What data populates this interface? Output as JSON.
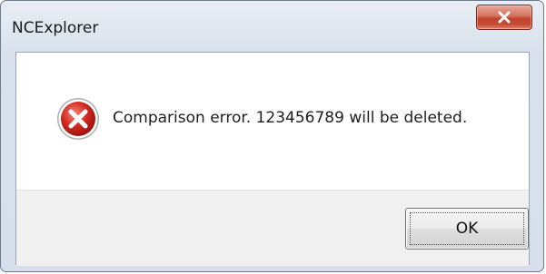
{
  "window": {
    "title": "NCExplorer",
    "close_icon": "close-icon"
  },
  "dialog": {
    "icon": "error-icon",
    "message": "Comparison error. 123456789 will be deleted.",
    "ok_label": "OK"
  },
  "colors": {
    "error_red": "#d02a2a",
    "close_button_red": "#c64a32",
    "button_face": "#ececec",
    "button_area": "#f0f0f0"
  }
}
